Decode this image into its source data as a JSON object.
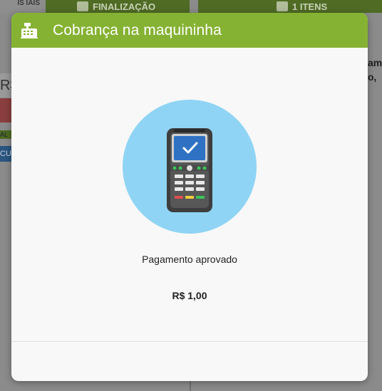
{
  "background": {
    "top_left_text": "ÍS\nIAIS",
    "tabs": [
      {
        "label": "FINALIZAÇÃO"
      },
      {
        "label": "1 ITENS"
      }
    ],
    "left_currency": "R$",
    "left_green_text": "AL",
    "left_blue_text": "CU",
    "right_text_1": "ame",
    "right_text_2": "o, "
  },
  "modal": {
    "title": "Cobrança na maquininha",
    "status": "Pagamento aprovado",
    "amount": "R$ 1,00",
    "icons": {
      "header": "cash-register-icon",
      "illustration": "card-machine-approved-icon"
    }
  },
  "colors": {
    "header": "#85b233",
    "circle": "#8fd4f4",
    "terminal_screen": "#2f72c4"
  }
}
